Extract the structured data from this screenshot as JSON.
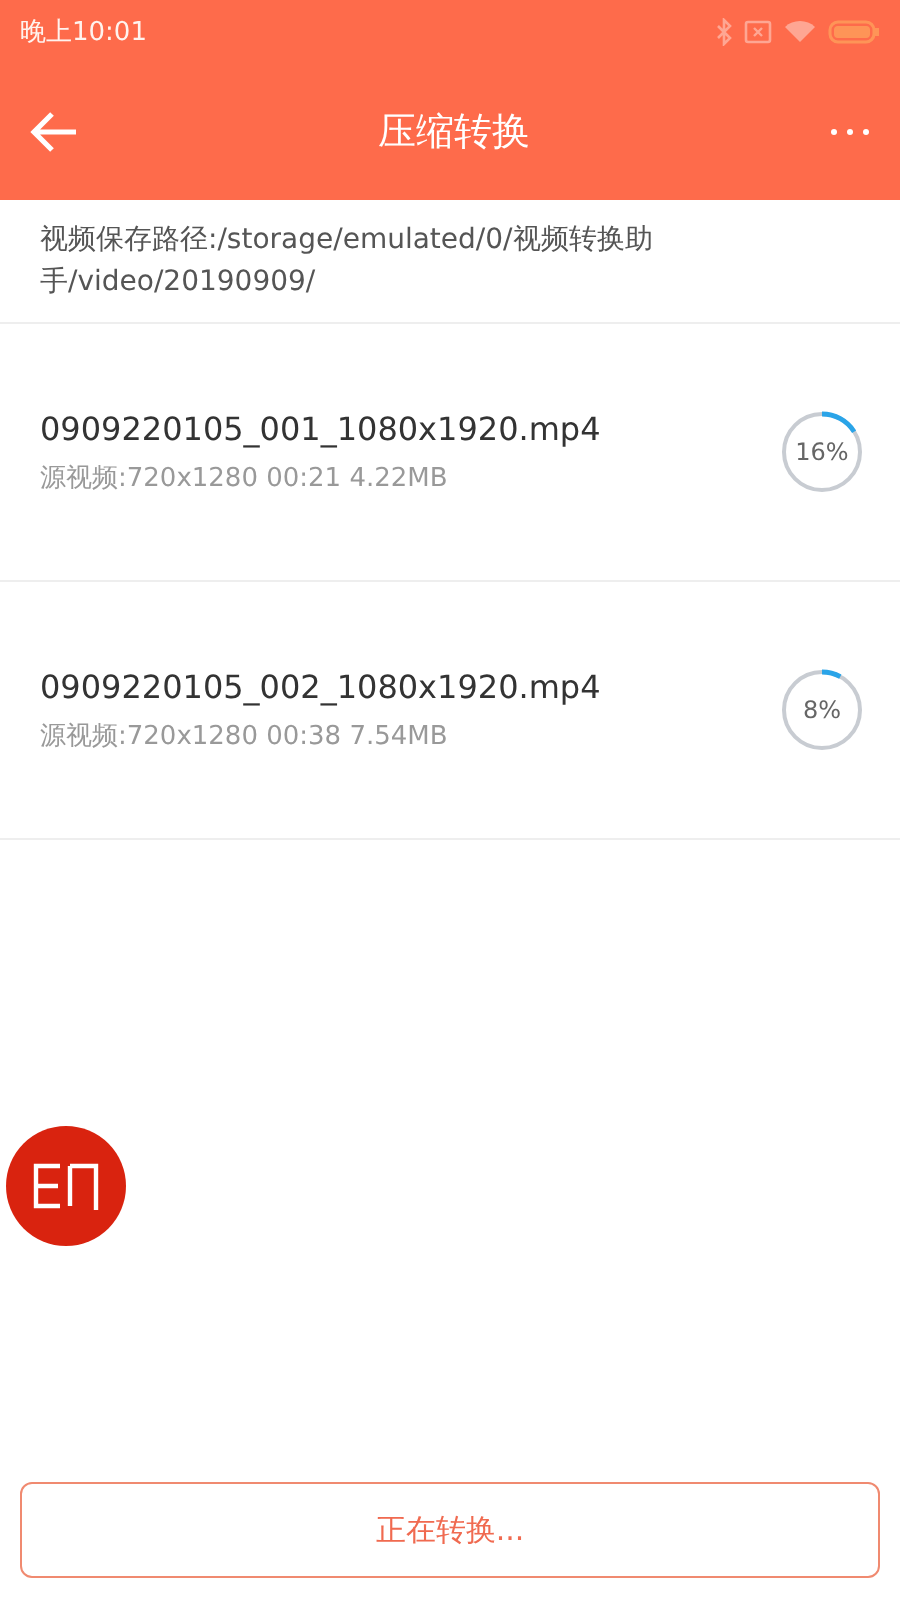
{
  "status_bar": {
    "time": "晚上10:01"
  },
  "app_bar": {
    "title": "压缩转换"
  },
  "save_path": "视频保存路径:/storage/emulated/0/视频转换助手/video/20190909/",
  "files": [
    {
      "name": "0909220105_001_1080x1920.mp4",
      "source": "源视频:720x1280 00:21 4.22MB",
      "percent": "16%"
    },
    {
      "name": "0909220105_002_1080x1920.mp4",
      "source": "源视频:720x1280 00:38 7.54MB",
      "percent": "8%"
    }
  ],
  "action_button": {
    "label": "正在转换...",
    "disabled": true
  }
}
